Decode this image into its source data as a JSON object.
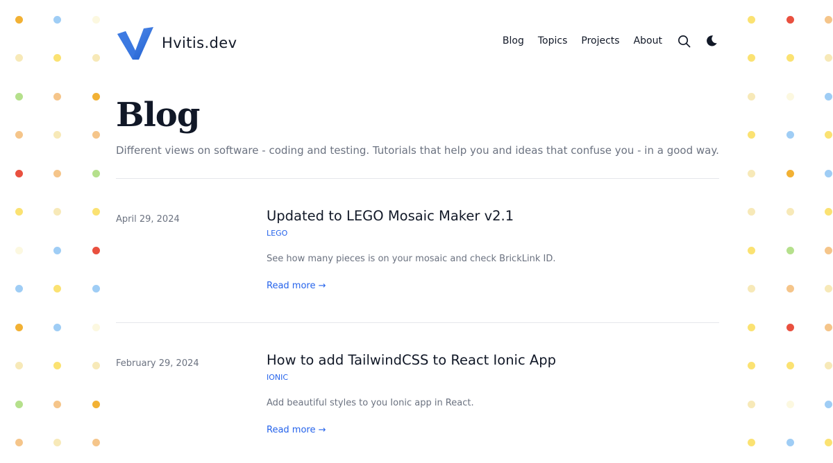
{
  "header": {
    "site_name": "Hvitis.dev",
    "nav": [
      "Blog",
      "Topics",
      "Projects",
      "About"
    ],
    "search_icon": "search-icon",
    "theme_icon": "moon-icon"
  },
  "page": {
    "title": "Blog",
    "subtitle": "Different views on software - coding and testing. Tutorials that help you and ideas that confuse you - in a good way."
  },
  "posts": [
    {
      "date": "April 29, 2024",
      "title": "Updated to LEGO Mosaic Maker v2.1",
      "tag": "LEGO",
      "description": "See how many pieces is on your mosaic and check BrickLink ID.",
      "read_more": "Read more →"
    },
    {
      "date": "February 29, 2024",
      "title": "How to add TailwindCSS to React Ionic App",
      "tag": "IONIC",
      "description": "Add beautiful styles to you Ionic app in React.",
      "read_more": "Read more →"
    }
  ],
  "colors": {
    "accent": "#2563eb",
    "text": "#111827",
    "muted": "#6b7280",
    "dot_palette": [
      "#f2b134",
      "#fbe272",
      "#b5e08c",
      "#9fcdf5",
      "#e9503f",
      "#f7e9b8",
      "#fcf8e0",
      "#f5c58a"
    ]
  }
}
